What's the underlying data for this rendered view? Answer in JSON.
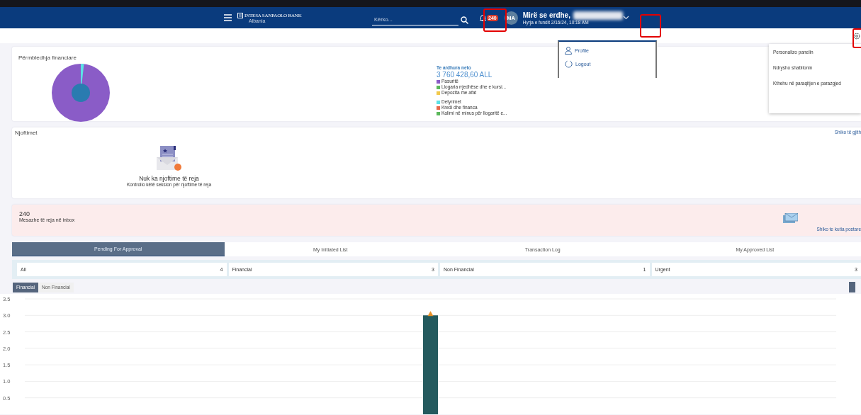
{
  "header": {
    "logo": {
      "name": "INTESA SANPAOLO BANK",
      "region": "Albania"
    },
    "search": {
      "placeholder": "Kërko..."
    },
    "notifications_badge": "240",
    "user": {
      "initials": "MA",
      "greeting": "Mirë se erdhe,",
      "last_login": "Hyrja e fundit 2/16/24, 10:18 AM"
    }
  },
  "user_menu": [
    {
      "kind": "profile",
      "label": "Profile"
    },
    {
      "kind": "logout",
      "label": "Logout"
    }
  ],
  "settings_menu": [
    "Personalizo panelin",
    "Ndrysho shabllonin",
    "Kthehu në paraqitjen e parazgjed"
  ],
  "financial_summary": {
    "title": "Përmbledhja financiare",
    "net_label": "Te ardhura neto",
    "net_value": "3 760 428,60 ALL",
    "assets": [
      {
        "label": "Pasuritë",
        "color": "#8a5cc7"
      },
      {
        "label": "Llogaria rrjedhëse dhe e kursi...",
        "color": "#5cb85c"
      },
      {
        "label": "Depozita me afat",
        "color": "#f2c94c"
      }
    ],
    "liabilities": [
      {
        "label": "Detyrimet",
        "color": "#5ce1e6"
      },
      {
        "label": "Kredi dhe financa",
        "color": "#e8684a"
      },
      {
        "label": "Kalimi në minus për llogaritë e...",
        "color": "#5cb85c"
      }
    ]
  },
  "notifications": {
    "title": "Njoftimet",
    "link": "Shiko të gjith",
    "empty_title": "Nuk ka njoftime të reja",
    "empty_text": "Kontrollo këtë seksion për njoftime të reja"
  },
  "messages": {
    "count": "240",
    "label": "Mesazhe të reja në inbox",
    "link": "Shiko te kutia postare"
  },
  "tabs": [
    {
      "label": "Pending For Approval",
      "selected": true
    },
    {
      "label": "My Initiated List",
      "selected": false
    },
    {
      "label": "Transaction Log",
      "selected": false
    },
    {
      "label": "My Approved List",
      "selected": false
    }
  ],
  "filters": [
    {
      "label": "All",
      "count": "4"
    },
    {
      "label": "Financial",
      "count": "3"
    },
    {
      "label": "Non Financial",
      "count": "1"
    },
    {
      "label": "Urgent",
      "count": "3"
    }
  ],
  "chart_toggle": [
    {
      "label": "Financial",
      "selected": true
    },
    {
      "label": "Non Financial",
      "selected": false
    }
  ],
  "chart": {
    "chart_data": {
      "type": "bar",
      "grid": true,
      "categories": [
        null
      ],
      "values": [
        3
      ],
      "ylim": [
        0,
        3.5
      ],
      "yticks": [
        {
          "value": 0.5,
          "label": "0.5"
        },
        {
          "value": 1,
          "label": "1.0"
        },
        {
          "value": 1.5,
          "label": "1.5"
        },
        {
          "value": 2,
          "label": "2.0"
        },
        {
          "value": 2.5,
          "label": "2.5"
        },
        {
          "value": 3,
          "label": "3.0"
        },
        {
          "value": 3.5,
          "label": "3.5"
        }
      ]
    }
  }
}
